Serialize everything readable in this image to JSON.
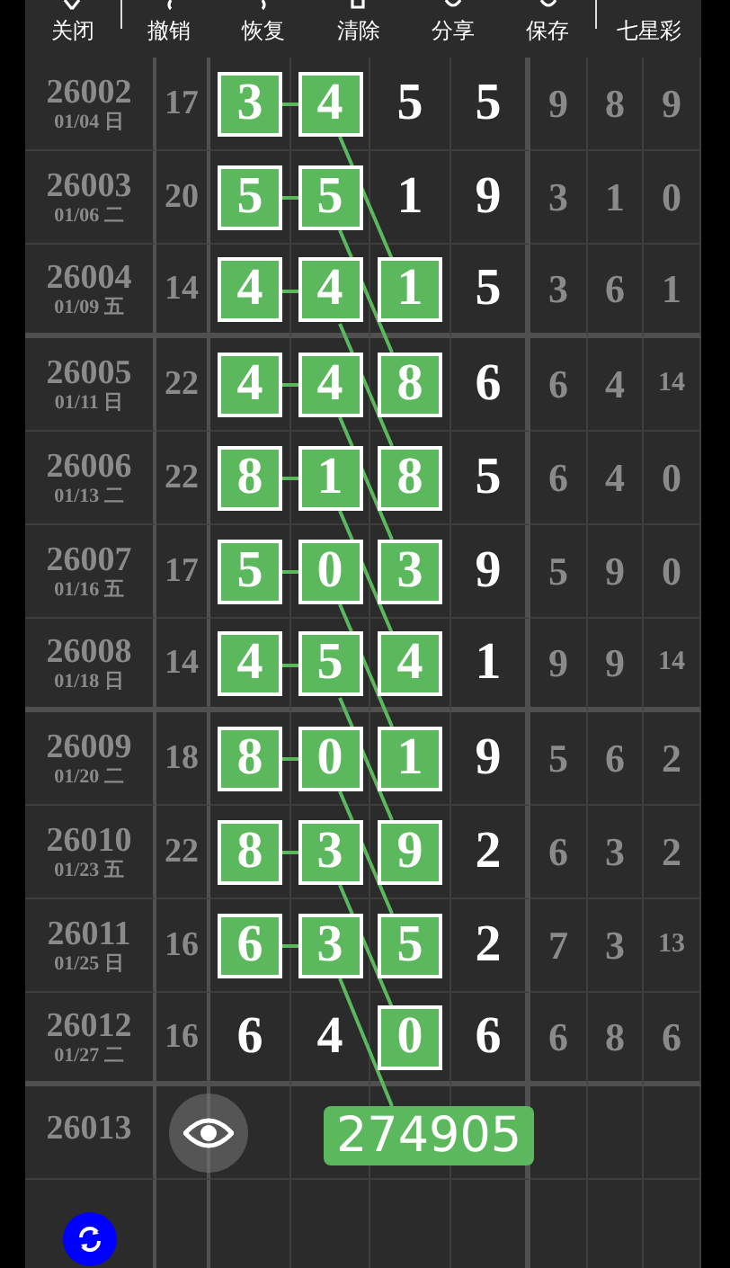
{
  "toolbar": {
    "actions": [
      {
        "label": "关闭"
      },
      {
        "label": "撤销"
      },
      {
        "label": "恢复"
      },
      {
        "label": "清除"
      },
      {
        "label": "分享"
      },
      {
        "label": "保存"
      }
    ],
    "lottery": "七星彩"
  },
  "rows": [
    {
      "issue": "26002",
      "date": "01/04 日",
      "sum": "17",
      "digits": [
        {
          "value": "3",
          "hit": true
        },
        {
          "value": "4",
          "hit": true
        },
        {
          "value": "5",
          "hit": false
        },
        {
          "value": "5",
          "hit": false
        }
      ],
      "extra": [
        "9",
        "8",
        "9"
      ]
    },
    {
      "issue": "26003",
      "date": "01/06 二",
      "sum": "20",
      "digits": [
        {
          "value": "5",
          "hit": true
        },
        {
          "value": "5",
          "hit": true
        },
        {
          "value": "1",
          "hit": false
        },
        {
          "value": "9",
          "hit": false
        }
      ],
      "extra": [
        "3",
        "1",
        "0"
      ]
    },
    {
      "issue": "26004",
      "date": "01/09 五",
      "sum": "14",
      "digits": [
        {
          "value": "4",
          "hit": true
        },
        {
          "value": "4",
          "hit": true
        },
        {
          "value": "1",
          "hit": true
        },
        {
          "value": "5",
          "hit": false
        }
      ],
      "extra": [
        "3",
        "6",
        "1"
      ]
    },
    {
      "issue": "26005",
      "date": "01/11 日",
      "sum": "22",
      "digits": [
        {
          "value": "4",
          "hit": true
        },
        {
          "value": "4",
          "hit": true
        },
        {
          "value": "8",
          "hit": true
        },
        {
          "value": "6",
          "hit": false
        }
      ],
      "extra": [
        "6",
        "4",
        "14"
      ]
    },
    {
      "issue": "26006",
      "date": "01/13 二",
      "sum": "22",
      "digits": [
        {
          "value": "8",
          "hit": true
        },
        {
          "value": "1",
          "hit": true
        },
        {
          "value": "8",
          "hit": true
        },
        {
          "value": "5",
          "hit": false
        }
      ],
      "extra": [
        "6",
        "4",
        "0"
      ]
    },
    {
      "issue": "26007",
      "date": "01/16 五",
      "sum": "17",
      "digits": [
        {
          "value": "5",
          "hit": true
        },
        {
          "value": "0",
          "hit": true
        },
        {
          "value": "3",
          "hit": true
        },
        {
          "value": "9",
          "hit": false
        }
      ],
      "extra": [
        "5",
        "9",
        "0"
      ]
    },
    {
      "issue": "26008",
      "date": "01/18 日",
      "sum": "14",
      "digits": [
        {
          "value": "4",
          "hit": true
        },
        {
          "value": "5",
          "hit": true
        },
        {
          "value": "4",
          "hit": true
        },
        {
          "value": "1",
          "hit": false
        }
      ],
      "extra": [
        "9",
        "9",
        "14"
      ]
    },
    {
      "issue": "26009",
      "date": "01/20 二",
      "sum": "18",
      "digits": [
        {
          "value": "8",
          "hit": true
        },
        {
          "value": "0",
          "hit": true
        },
        {
          "value": "1",
          "hit": true
        },
        {
          "value": "9",
          "hit": false
        }
      ],
      "extra": [
        "5",
        "6",
        "2"
      ]
    },
    {
      "issue": "26010",
      "date": "01/23 五",
      "sum": "22",
      "digits": [
        {
          "value": "8",
          "hit": true
        },
        {
          "value": "3",
          "hit": true
        },
        {
          "value": "9",
          "hit": true
        },
        {
          "value": "2",
          "hit": false
        }
      ],
      "extra": [
        "6",
        "3",
        "2"
      ]
    },
    {
      "issue": "26011",
      "date": "01/25 日",
      "sum": "16",
      "digits": [
        {
          "value": "6",
          "hit": true
        },
        {
          "value": "3",
          "hit": true
        },
        {
          "value": "5",
          "hit": true
        },
        {
          "value": "2",
          "hit": false
        }
      ],
      "extra": [
        "7",
        "3",
        "13"
      ]
    },
    {
      "issue": "26012",
      "date": "01/27 二",
      "sum": "16",
      "digits": [
        {
          "value": "6",
          "hit": false
        },
        {
          "value": "4",
          "hit": false
        },
        {
          "value": "0",
          "hit": true
        },
        {
          "value": "6",
          "hit": false
        }
      ],
      "extra": [
        "6",
        "8",
        "6"
      ]
    }
  ],
  "next": {
    "issue": "26013",
    "prediction": "274905"
  }
}
